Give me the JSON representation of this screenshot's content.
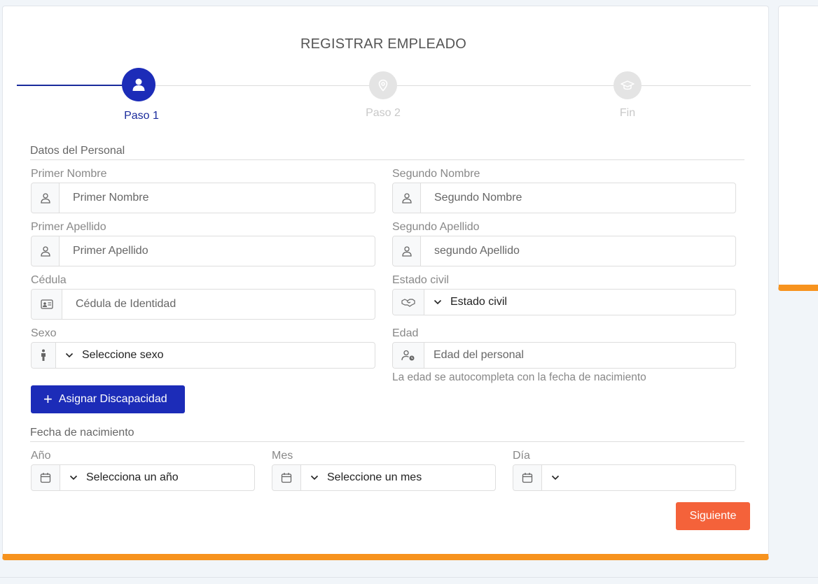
{
  "form": {
    "title": "REGISTRAR EMPLEADO",
    "steps": [
      {
        "label": "Paso 1",
        "icon": "user-icon",
        "state": "active"
      },
      {
        "label": "Paso 2",
        "icon": "location-pin-icon",
        "state": "inactive"
      },
      {
        "label": "Fin",
        "icon": "graduation-cap-icon",
        "state": "inactive"
      }
    ],
    "section_personal": "Datos del Personal",
    "fields": {
      "primer_nombre": {
        "label": "Primer Nombre",
        "placeholder": "Primer Nombre"
      },
      "segundo_nombre": {
        "label": "Segundo Nombre",
        "placeholder": "Segundo Nombre"
      },
      "primer_apellido": {
        "label": "Primer Apellido",
        "placeholder": "Primer Apellido"
      },
      "segundo_apellido": {
        "label": "Segundo Apellido",
        "placeholder": "segundo Apellido"
      },
      "cedula": {
        "label": "Cédula",
        "placeholder": "Cédula de Identidad"
      },
      "estado_civil": {
        "label": "Estado civil",
        "selected": "Estado civil"
      },
      "sexo": {
        "label": "Sexo",
        "selected": "Seleccione sexo"
      },
      "edad": {
        "label": "Edad",
        "placeholder": "Edad del personal",
        "hint": "La edad se autocompleta con la fecha de nacimiento"
      }
    },
    "assign_disability_button": "Asignar Discapacidad",
    "section_birth": "Fecha de nacimiento",
    "birth": {
      "year": {
        "label": "Año",
        "selected": "Selecciona un año"
      },
      "month": {
        "label": "Mes",
        "selected": "Seleccione un mes"
      },
      "day": {
        "label": "Día",
        "selected": ""
      }
    },
    "next_button": "Siguiente"
  },
  "colors": {
    "primary": "#1c2cb8",
    "accent": "#f7931e",
    "next": "#f4623a"
  }
}
